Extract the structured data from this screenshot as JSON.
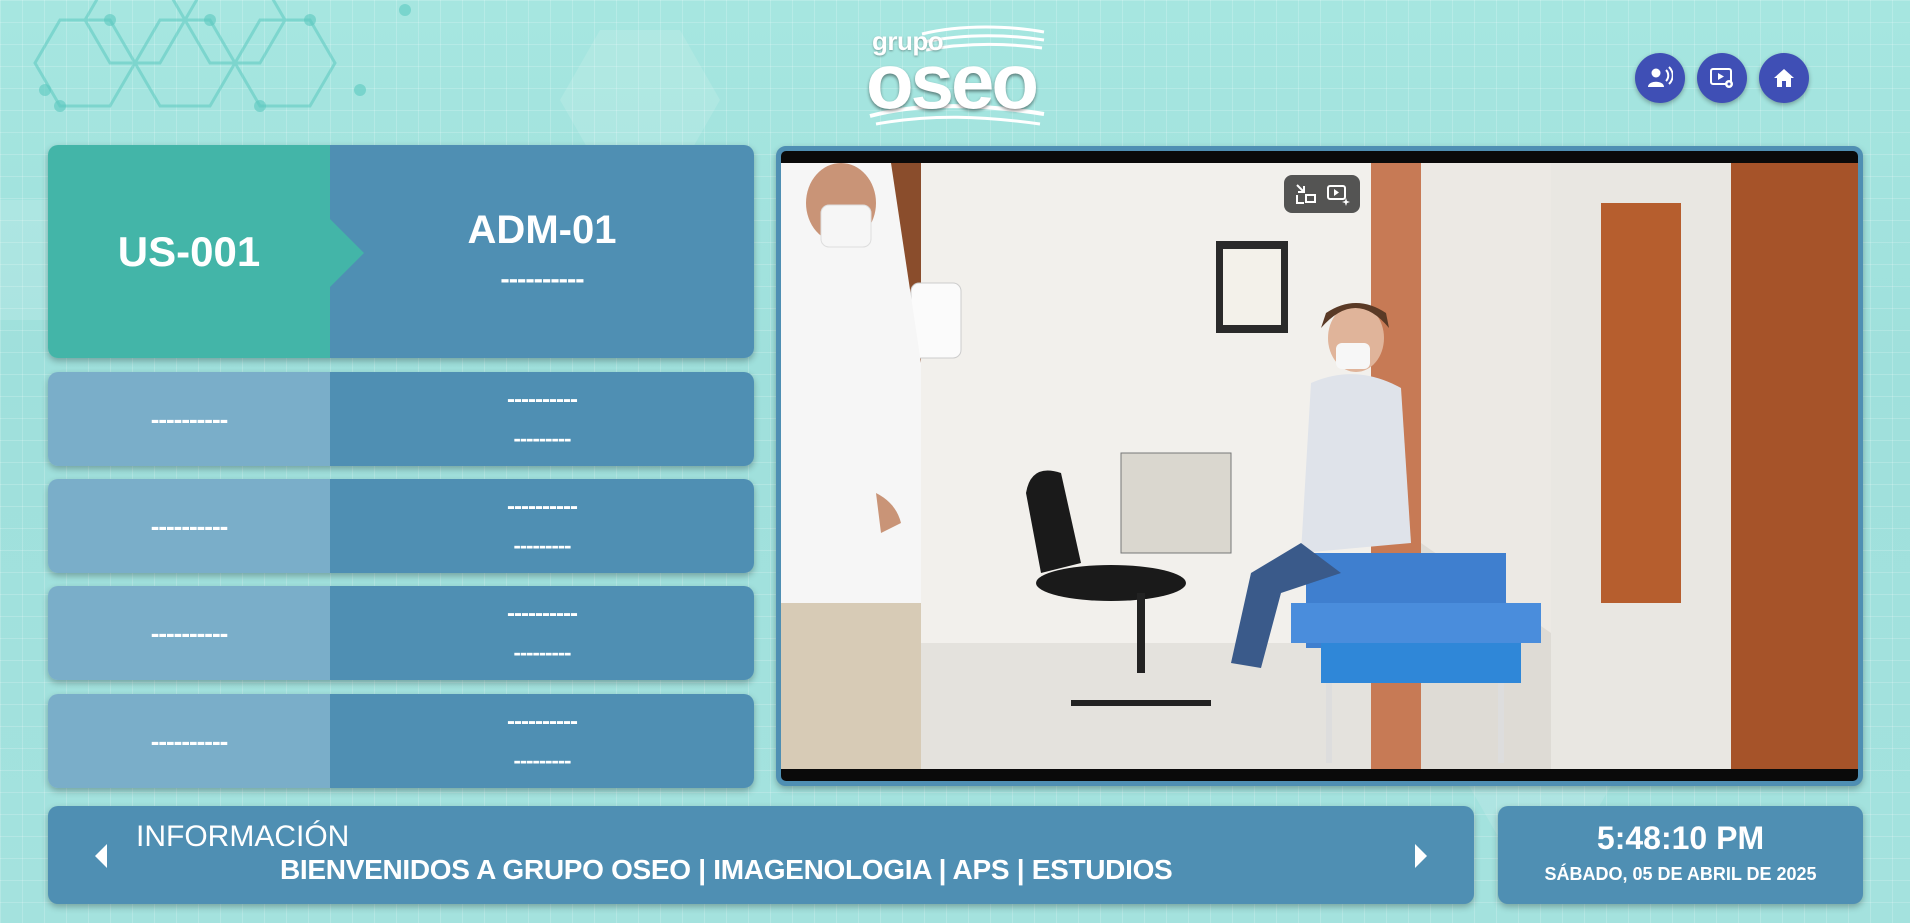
{
  "header": {
    "logo_small": "grupo",
    "logo_big": "oseo",
    "buttons": [
      {
        "icon": "announce-icon"
      },
      {
        "icon": "video-settings-icon"
      },
      {
        "icon": "home-icon"
      }
    ]
  },
  "queue": {
    "current": {
      "ticket": "US-001",
      "station": "ADM-01",
      "detail": "----------"
    },
    "pending": [
      {
        "ticket": "----------",
        "station": "----------",
        "detail": "---------"
      },
      {
        "ticket": "----------",
        "station": "----------",
        "detail": "---------"
      },
      {
        "ticket": "----------",
        "station": "----------",
        "detail": "---------"
      },
      {
        "ticket": "----------",
        "station": "----------",
        "detail": "---------"
      }
    ]
  },
  "video": {
    "controls": [
      {
        "icon": "exit-pip-icon"
      },
      {
        "icon": "video-enhance-icon"
      }
    ]
  },
  "info": {
    "title": "INFORMACIÓN",
    "text": "BIENVENIDOS A GRUPO OSEO | IMAGENOLOGIA | APS | ESTUDIOS"
  },
  "clock": {
    "time": "5:48:10 PM",
    "date": "SÁBADO, 05 DE ABRIL DE 2025"
  },
  "colors": {
    "accent_teal": "#43b5a8",
    "panel_blue": "#4f8fb3",
    "panel_light": "#7aaec9",
    "button_indigo": "#3f4fb5",
    "background": "#a6e6e0"
  }
}
